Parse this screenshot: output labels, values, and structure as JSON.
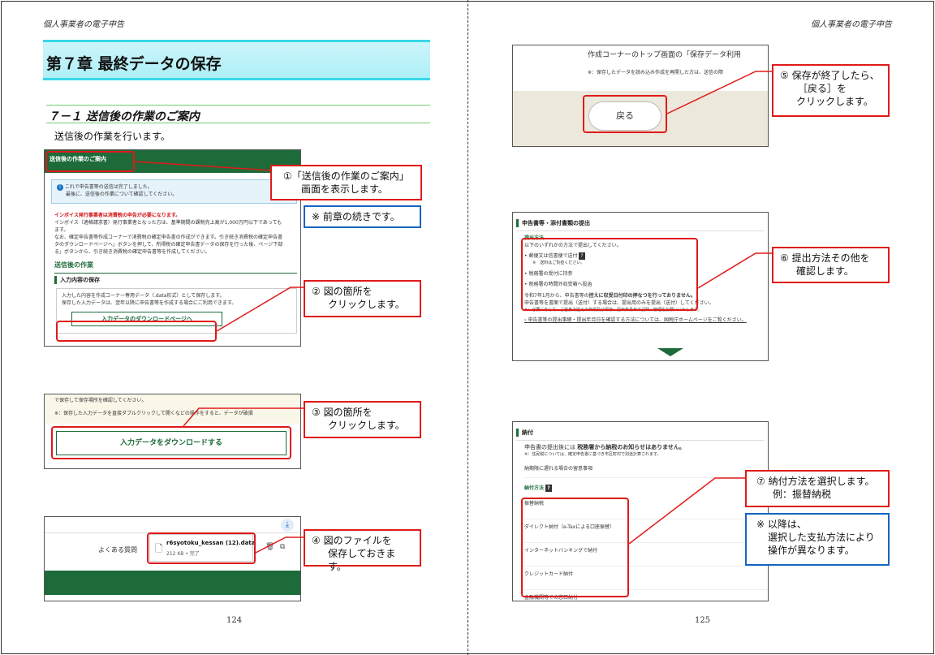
{
  "header_left": "個人事業者の電子申告",
  "header_right": "個人事業者の電子申告",
  "page_left_number": "124",
  "page_right_number": "125",
  "chapter_title": "第７章 最終データの保存",
  "section_title": "７－１ 送信後の作業のご案内",
  "intro_text": "送信後の作業を行います。",
  "shot1": {
    "header": "送信後の作業のご案内",
    "info_line1": "これで申告書等の送信は完了しました。",
    "info_line2": "最後に、送信後の作業について確認してください。",
    "invoice_title": "インボイス発行事業者は消費税の申告が必要になります。",
    "invoice_line1": "インボイス（適格請求書）発行事業者となった方は、基準期間の課税売上高が1,000万円以下であっても",
    "invoice_line2": "ます。",
    "invoice_line3": "なお、確定申告書等作成コーナーで消費税の確定申告書の作成ができます。引き続き消費税の確定申告書",
    "invoice_line4": "タのダウンロードページへ」ボタンを押して、所得税の確定申告書データの保存を行った後、ページ下部",
    "invoice_line5": "る」ボタンから、引き続き消費税の確定申告書等を作成してください。",
    "after_work_title": "送信後の作業",
    "input_save_label": "入力内容の保存",
    "save_line1": "入力した内容を作成コーナー専用データ（.data形式）として保存します。",
    "save_line2": "保存した入力データは、翌年以降に申告書等を作成する場合にご利用できます。",
    "download_page_button": "入力データのダウンロードページへ"
  },
  "shot2": {
    "top_line": "で保存して保存場所を確認してください。",
    "note_line": "※：保存した入力データを直接ダブルクリックして開くなどの操作をすると、データが破損",
    "download_button": "入力データをダウンロードする"
  },
  "shot3": {
    "faq_link": "よくある質問",
    "file_name": "r6syotoku_kessan (12).data",
    "file_meta": "212 KB • 完了"
  },
  "shot5": {
    "top_line": "作成コーナーのトップ画面の「保存データ利用",
    "note_line": "※：保存したデータを読み込み作成を再開した方は、送信の際",
    "back_button": "戻る"
  },
  "shot6": {
    "header": "申告書等・添付書類の提出",
    "method_title": "提出方法",
    "method_intro": "以下のいずれかの方法で提出してください。",
    "item1": "郵便又は信書便で送付",
    "item1_note": "※　送料はご負担ください。",
    "item2": "税務署の受付に持参",
    "item3": "税務署の時間外収受箱へ投函",
    "deadline_line1": "令和7年1月から、申告書等の",
    "deadline_bold": "控えに収受日付印の押なつを行っておりません。",
    "deadline_line2": "申告書等を書面で提出（送付）する場合は、提出用のみを提出（送付）してください。",
    "deadline_line3": "※：必要に応じて、ご自身で控えの作成及び保存、提出年月日の記録・管理をお願いいたします。",
    "link_text": "申告書等の提出事績・提出年月日を確認する方法については、国税庁ホームページをご覧ください。"
  },
  "shot7": {
    "header": "納付",
    "notice_prefix": "申告書の提出後には",
    "notice_bold": "税務署から納税のお知らせはありません。",
    "notice_sub": "※：住民税については、確定申告書に基づき市区町村で別途計算されます。",
    "late_link": "納期限に遅れる場合の留意事項",
    "method_title": "納付方法",
    "methods": [
      "振替納税",
      "ダイレクト納付（e-Taxによる口座振替）",
      "インターネットバンキングで納付",
      "クレジットカード納付",
      "金融機関等での窓口納付"
    ]
  },
  "callouts": {
    "c1_line1": "①「送信後の作業のご案内」",
    "c1_line2": "画面を表示します。",
    "note1": "※ 前章の続きです。",
    "c2_line1": "② 図の箇所を",
    "c2_line2": "クリックします。",
    "c3_line1": "③ 図の箇所を",
    "c3_line2": "クリックします。",
    "c4_line1": "④ 図のファイルを",
    "c4_line2": "保存しておきます。",
    "c5_line1": "⑤ 保存が終了したら、",
    "c5_line2": "［戻る］を",
    "c5_line3": "クリックします。",
    "c6_line1": "⑥ 提出方法その他を",
    "c6_line2": "確認します。",
    "c7_line1": "⑦ 納付方法を選択します。",
    "c7_line2": "例：振替納税",
    "note2_line1": "※ 以降は、",
    "note2_line2": "選択した支払方法により",
    "note2_line3": "操作が異なります。"
  },
  "colors": {
    "accent_red": "#e01a1a",
    "note_blue": "#1565c0",
    "etax_green": "#1e6b3a",
    "chapter_cyan": "#38d7e8"
  }
}
